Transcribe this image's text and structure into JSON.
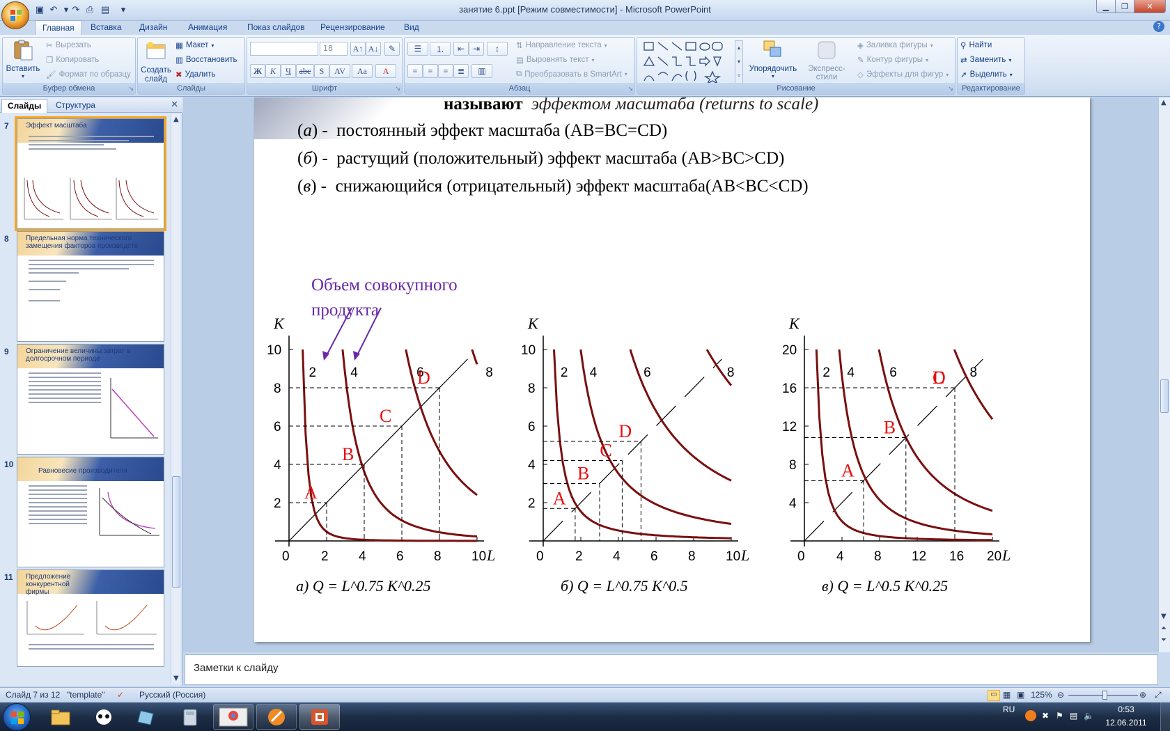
{
  "window": {
    "title": "занятие 6.ppt [Режим совместимости] - Microsoft PowerPoint"
  },
  "tabs": [
    "Главная",
    "Вставка",
    "Дизайн",
    "Анимация",
    "Показ слайдов",
    "Рецензирование",
    "Вид"
  ],
  "ribbon": {
    "clipboard": {
      "label": "Буфер обмена",
      "paste": "Вставить",
      "cut": "Вырезать",
      "copy": "Копировать",
      "format_painter": "Формат по образцу"
    },
    "slides": {
      "label": "Слайды",
      "new_slide": "Создать слайд",
      "layout": "Макет",
      "reset": "Восстановить",
      "delete": "Удалить"
    },
    "font": {
      "label": "Шрифт",
      "font_size": "18"
    },
    "paragraph": {
      "label": "Абзац",
      "text_direction": "Направление текста",
      "align_text": "Выровнять текст",
      "smartart": "Преобразовать в SmartArt"
    },
    "drawing": {
      "label": "Рисование",
      "arrange": "Упорядочить",
      "quick_styles": "Экспресс-стили",
      "shape_fill": "Заливка фигуры",
      "shape_outline": "Контур фигуры",
      "shape_effects": "Эффекты для фигур"
    },
    "editing": {
      "label": "Редактирование",
      "find": "Найти",
      "replace": "Заменить",
      "select": "Выделить"
    }
  },
  "left_panel": {
    "tabs": [
      "Слайды",
      "Структура"
    ],
    "slides": [
      {
        "number": "7",
        "title": "Эффект масштаба"
      },
      {
        "number": "8",
        "title": "Предельная норма технического замещения факторов производств"
      },
      {
        "number": "9",
        "title": "Ограничение величины затрат в долгосрочном периоде"
      },
      {
        "number": "10",
        "title": "Равновесие производителя"
      },
      {
        "number": "11",
        "title": "Предложение конкурентной фирмы"
      }
    ]
  },
  "slide": {
    "line0_prefix": "называют",
    "line0_italic": "эффектом масштаба (returns to scale)",
    "items": [
      {
        "mark": "а",
        "text": "постоянный эффект масштаба (AB=BC=CD)"
      },
      {
        "mark": "б",
        "text": "растущий (положительный) эффект масштаба (AB>BC>CD)"
      },
      {
        "mark": "в",
        "text": "снижающийся (отрицательный) эффект масштаба(AB<BC<CD)"
      }
    ],
    "annotation_line1": "Объем совокупного",
    "annotation_line2": "продукта"
  },
  "chart_data": [
    {
      "type": "line",
      "caption": "а) Q = L^0.75 K^0.25",
      "xlabel": "L",
      "ylabel": "K",
      "xticks": [
        0,
        2,
        4,
        6,
        8,
        10
      ],
      "yticks": [
        2,
        4,
        6,
        8,
        10
      ],
      "xlim": [
        0,
        10
      ],
      "ylim": [
        0,
        10
      ],
      "isoquants": [
        2,
        4,
        6,
        8
      ],
      "points": [
        {
          "label": "A",
          "L": 2,
          "K": 2
        },
        {
          "label": "B",
          "L": 4,
          "K": 4
        },
        {
          "label": "C",
          "L": 6,
          "K": 6
        },
        {
          "label": "D",
          "L": 8,
          "K": 8
        }
      ]
    },
    {
      "type": "line",
      "caption": "б) Q = L^0.75 K^0.5",
      "xlabel": "L",
      "ylabel": "K",
      "xticks": [
        0,
        2,
        4,
        6,
        8,
        10
      ],
      "yticks": [
        2,
        4,
        6,
        8,
        10
      ],
      "xlim": [
        0,
        10
      ],
      "ylim": [
        0,
        10
      ],
      "isoquants": [
        2,
        4,
        6,
        8
      ],
      "points": [
        {
          "label": "A",
          "L": 1.7,
          "K": 1.7
        },
        {
          "label": "B",
          "L": 3.0,
          "K": 3.0
        },
        {
          "label": "C",
          "L": 4.2,
          "K": 4.2
        },
        {
          "label": "D",
          "L": 5.2,
          "K": 5.2
        }
      ]
    },
    {
      "type": "line",
      "caption": "в) Q = L^0.5 K^0.25",
      "xlabel": "L",
      "ylabel": "K",
      "xticks": [
        0,
        4,
        8,
        12,
        16,
        20
      ],
      "yticks": [
        4,
        8,
        12,
        16,
        20
      ],
      "xlim": [
        0,
        20
      ],
      "ylim": [
        0,
        20
      ],
      "isoquants": [
        2,
        4,
        6,
        8
      ],
      "points": [
        {
          "label": "A",
          "L": 6.3,
          "K": 6.3
        },
        {
          "label": "B",
          "L": 10.8,
          "K": 10.8
        },
        {
          "label": "C",
          "L": 16,
          "K": 16
        },
        {
          "label": "D",
          "L": 16,
          "K": 16
        }
      ]
    }
  ],
  "notes": {
    "placeholder": "Заметки к слайду"
  },
  "status": {
    "slide": "Слайд 7 из 12",
    "theme": "\"template\"",
    "language": "Русский (Россия)",
    "zoom": "125%"
  },
  "taskbar": {
    "lang": "RU",
    "time": "0:53",
    "date": "12.06.2011"
  },
  "colors": {
    "curve": "#7a1010",
    "point_label": "#e81010",
    "annotation": "#6a2aa6",
    "ribbon_text": "#15428b"
  }
}
